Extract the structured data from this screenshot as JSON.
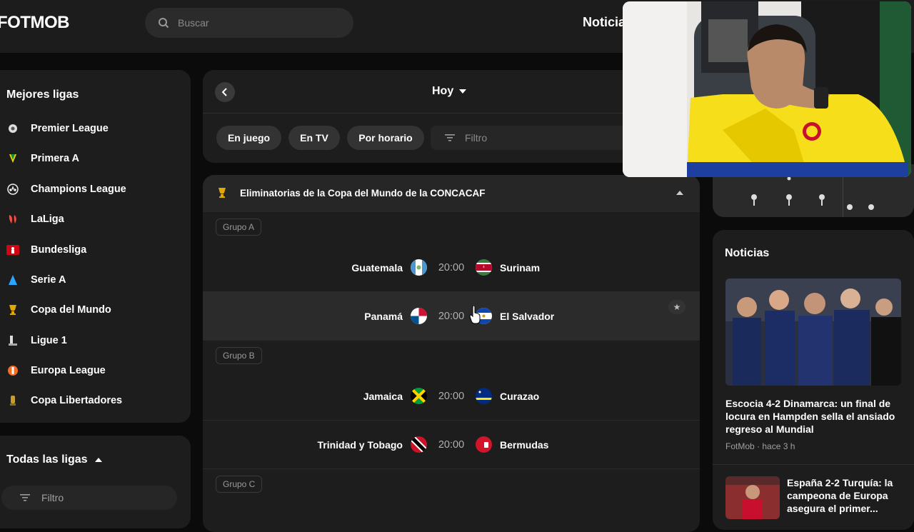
{
  "header": {
    "logo": "FOTMOB",
    "search_placeholder": "Buscar",
    "nav_news": "Noticias"
  },
  "sidebar": {
    "top_title": "Mejores ligas",
    "leagues": [
      {
        "label": "Premier League",
        "icon": "premier-league-icon"
      },
      {
        "label": "Primera A",
        "icon": "primera-a-icon"
      },
      {
        "label": "Champions League",
        "icon": "champions-league-icon"
      },
      {
        "label": "LaLiga",
        "icon": "laliga-icon"
      },
      {
        "label": "Bundesliga",
        "icon": "bundesliga-icon"
      },
      {
        "label": "Serie A",
        "icon": "serie-a-icon"
      },
      {
        "label": "Copa del Mundo",
        "icon": "world-cup-trophy-icon"
      },
      {
        "label": "Ligue 1",
        "icon": "ligue-1-icon"
      },
      {
        "label": "Europa League",
        "icon": "europa-league-icon"
      },
      {
        "label": "Copa Libertadores",
        "icon": "libertadores-icon"
      }
    ],
    "all_title": "Todas las ligas",
    "filter_placeholder": "Filtro"
  },
  "day_nav": {
    "date_label": "Hoy",
    "chips": [
      "En juego",
      "En TV",
      "Por horario"
    ],
    "filter_placeholder": "Filtro"
  },
  "competition": {
    "title": "Eliminatorias de la Copa del Mundo de la CONCACAF",
    "groups": [
      {
        "name": "Grupo A",
        "matches": [
          {
            "home": "Guatemala",
            "time": "20:00",
            "away": "Surinam"
          },
          {
            "home": "Panamá",
            "time": "20:00",
            "away": "El Salvador"
          }
        ]
      },
      {
        "name": "Grupo B",
        "matches": [
          {
            "home": "Jamaica",
            "time": "20:00",
            "away": "Curazao"
          },
          {
            "home": "Trinidad y Tobago",
            "time": "20:00",
            "away": "Bermudas"
          }
        ]
      },
      {
        "name": "Grupo C",
        "matches": []
      }
    ]
  },
  "news": {
    "title": "Noticias",
    "items": [
      {
        "title": "Escocia 4-2 Dinamarca: un final de locura en Hampden sella el ansiado regreso al Mundial",
        "meta": "FotMob · hace 3 h"
      },
      {
        "title": "España 2-2 Turquía: la campeona de Europa asegura el primer..."
      }
    ]
  },
  "colors": {
    "background": "#0b0b0b",
    "panel": "#1d1d1d",
    "highlight_row": "#2b2b2b",
    "accent_gold": "#e0a800"
  }
}
